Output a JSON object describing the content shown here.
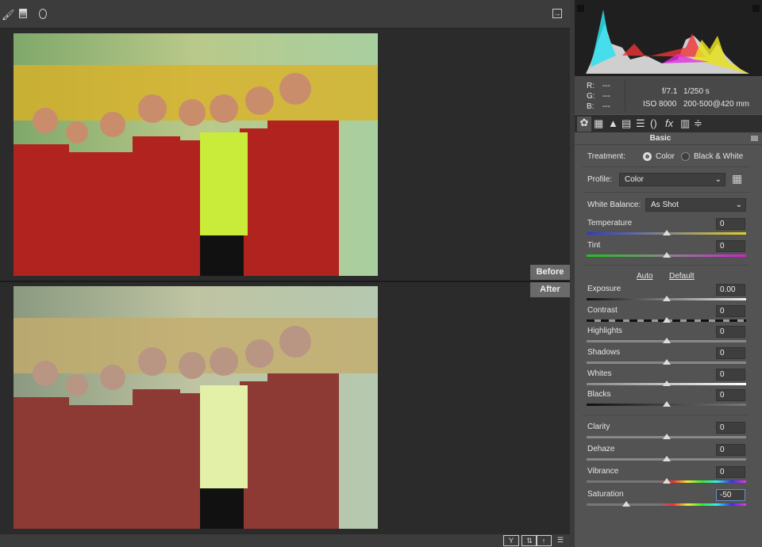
{
  "toolbar": {
    "icons": [
      "brush-icon",
      "gradient-filter-icon",
      "radial-filter-icon"
    ],
    "open_icon": "open-object-icon"
  },
  "compare": {
    "before_label": "Before",
    "after_label": "After"
  },
  "bottom_icons": [
    "before-after-view-icon",
    "swap-settings-icon",
    "copy-settings-icon",
    "preferences-icon"
  ],
  "info": {
    "r_label": "R:",
    "g_label": "G:",
    "b_label": "B:",
    "r": "---",
    "g": "---",
    "b": "---",
    "aperture": "f/7.1",
    "shutter": "1/250 s",
    "iso": "ISO 8000",
    "lens": "200-500@420 mm"
  },
  "tabs": [
    "basic-icon",
    "tone-curve-icon",
    "detail-icon",
    "hsl-icon",
    "split-toning-icon",
    "lens-corrections-icon",
    "effects-icon",
    "camera-calibration-icon",
    "presets-icon"
  ],
  "panel": {
    "title": "Basic",
    "treatment_label": "Treatment:",
    "color_label": "Color",
    "bw_label": "Black & White",
    "treatment_selected": "Color",
    "profile_label": "Profile:",
    "profile_value": "Color",
    "wb_label": "White Balance:",
    "wb_value": "As Shot",
    "auto_label": "Auto",
    "default_label": "Default",
    "sliders": [
      {
        "label": "Temperature",
        "value": "0",
        "level": 0,
        "track": "temp"
      },
      {
        "label": "Tint",
        "value": "0",
        "level": 0,
        "track": "tint"
      },
      {
        "label": "Exposure",
        "value": "0.00",
        "level": 0,
        "track": "exp"
      },
      {
        "label": "Contrast",
        "value": "0",
        "level": 0,
        "track": "con"
      },
      {
        "label": "Highlights",
        "value": "0",
        "level": 0,
        "track": "gray"
      },
      {
        "label": "Shadows",
        "value": "0",
        "level": 0,
        "track": "gray"
      },
      {
        "label": "Whites",
        "value": "0",
        "level": 0,
        "track": "white"
      },
      {
        "label": "Blacks",
        "value": "0",
        "level": 0,
        "track": "black"
      },
      {
        "label": "Clarity",
        "value": "0",
        "level": 0,
        "track": "gray"
      },
      {
        "label": "Dehaze",
        "value": "0",
        "level": 0,
        "track": "gray"
      },
      {
        "label": "Vibrance",
        "value": "0",
        "level": 0,
        "track": "sat"
      },
      {
        "label": "Saturation",
        "value": "-50",
        "level": -50,
        "track": "sat"
      }
    ]
  }
}
